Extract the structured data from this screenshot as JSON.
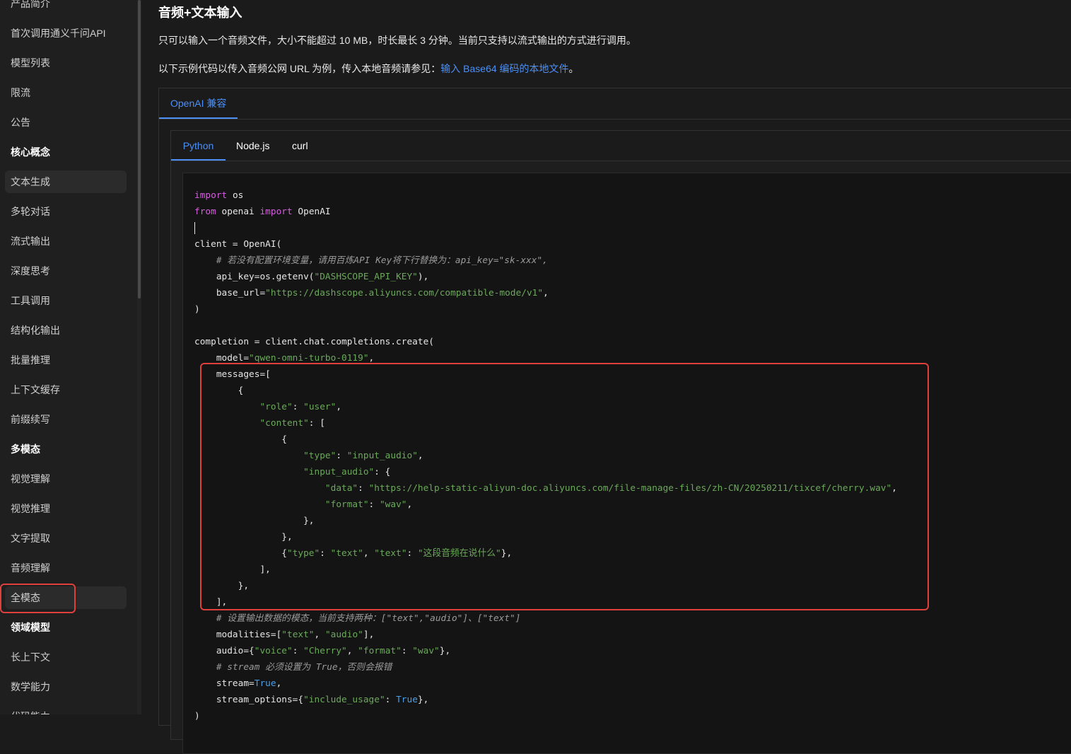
{
  "sidebar": {
    "items": [
      {
        "label": "产品简介",
        "type": "item"
      },
      {
        "label": "首次调用通义千问API",
        "type": "item"
      },
      {
        "label": "模型列表",
        "type": "item"
      },
      {
        "label": "限流",
        "type": "item"
      },
      {
        "label": "公告",
        "type": "item"
      },
      {
        "label": "核心概念",
        "type": "group"
      },
      {
        "label": "文本生成",
        "type": "item"
      },
      {
        "label": "多轮对话",
        "type": "item"
      },
      {
        "label": "流式输出",
        "type": "item"
      },
      {
        "label": "深度思考",
        "type": "item"
      },
      {
        "label": "工具调用",
        "type": "item"
      },
      {
        "label": "结构化输出",
        "type": "item"
      },
      {
        "label": "批量推理",
        "type": "item"
      },
      {
        "label": "上下文缓存",
        "type": "item"
      },
      {
        "label": "前缀续写",
        "type": "item"
      },
      {
        "label": "多模态",
        "type": "group"
      },
      {
        "label": "视觉理解",
        "type": "item"
      },
      {
        "label": "视觉推理",
        "type": "item"
      },
      {
        "label": "文字提取",
        "type": "item"
      },
      {
        "label": "音频理解",
        "type": "item"
      },
      {
        "label": "全模态",
        "type": "item"
      },
      {
        "label": "领域模型",
        "type": "group"
      },
      {
        "label": "长上下文",
        "type": "item"
      },
      {
        "label": "数学能力",
        "type": "item"
      },
      {
        "label": "代码能力",
        "type": "item"
      }
    ]
  },
  "content": {
    "heading": "音频+文本输入",
    "para1": "只可以输入一个音频文件，大小不能超过 10 MB，时长最长 3 分钟。当前只支持以流式输出的方式进行调用。",
    "para2_prefix": "以下示例代码以传入音频公网 URL 为例，传入本地音频请参见：",
    "para2_link": "输入 Base64 编码的本地文件",
    "para2_suffix": "。",
    "outer_tab": "OpenAI 兼容",
    "inner_tabs": [
      "Python",
      "Node.js",
      "curl"
    ]
  },
  "code": {
    "language": "python",
    "lines": [
      "import os",
      "from openai import OpenAI",
      "",
      "client = OpenAI(",
      "    # 若没有配置环境变量，请用百炼API Key将下行替换为：api_key=\"sk-xxx\",",
      "    api_key=os.getenv(\"DASHSCOPE_API_KEY\"),",
      "    base_url=\"https://dashscope.aliyuncs.com/compatible-mode/v1\",",
      ")",
      "",
      "completion = client.chat.completions.create(",
      "    model=\"qwen-omni-turbo-0119\",",
      "    messages=[",
      "        {",
      "            \"role\": \"user\",",
      "            \"content\": [",
      "                {",
      "                    \"type\": \"input_audio\",",
      "                    \"input_audio\": {",
      "                        \"data\": \"https://help-static-aliyun-doc.aliyuncs.com/file-manage-files/zh-CN/20250211/tixcef/cherry.wav\",",
      "                        \"format\": \"wav\",",
      "                    },",
      "                },",
      "                {\"type\": \"text\", \"text\": \"这段音频在说什么\"},",
      "            ],",
      "        },",
      "    ],",
      "    # 设置输出数据的模态，当前支持两种：[\"text\",\"audio\"]、[\"text\"]",
      "    modalities=[\"text\", \"audio\"],",
      "    audio={\"voice\": \"Cherry\", \"format\": \"wav\"},",
      "    # stream 必须设置为 True，否则会报错",
      "    stream=True,",
      "    stream_options={\"include_usage\": True},",
      ")"
    ]
  },
  "colors": {
    "accent": "#4c8ff5",
    "highlight_border": "#e0403b",
    "keyword": "#d55fde",
    "string": "#6ba95a",
    "comment": "#9a9a9a",
    "boolean": "#4c9fe6"
  }
}
